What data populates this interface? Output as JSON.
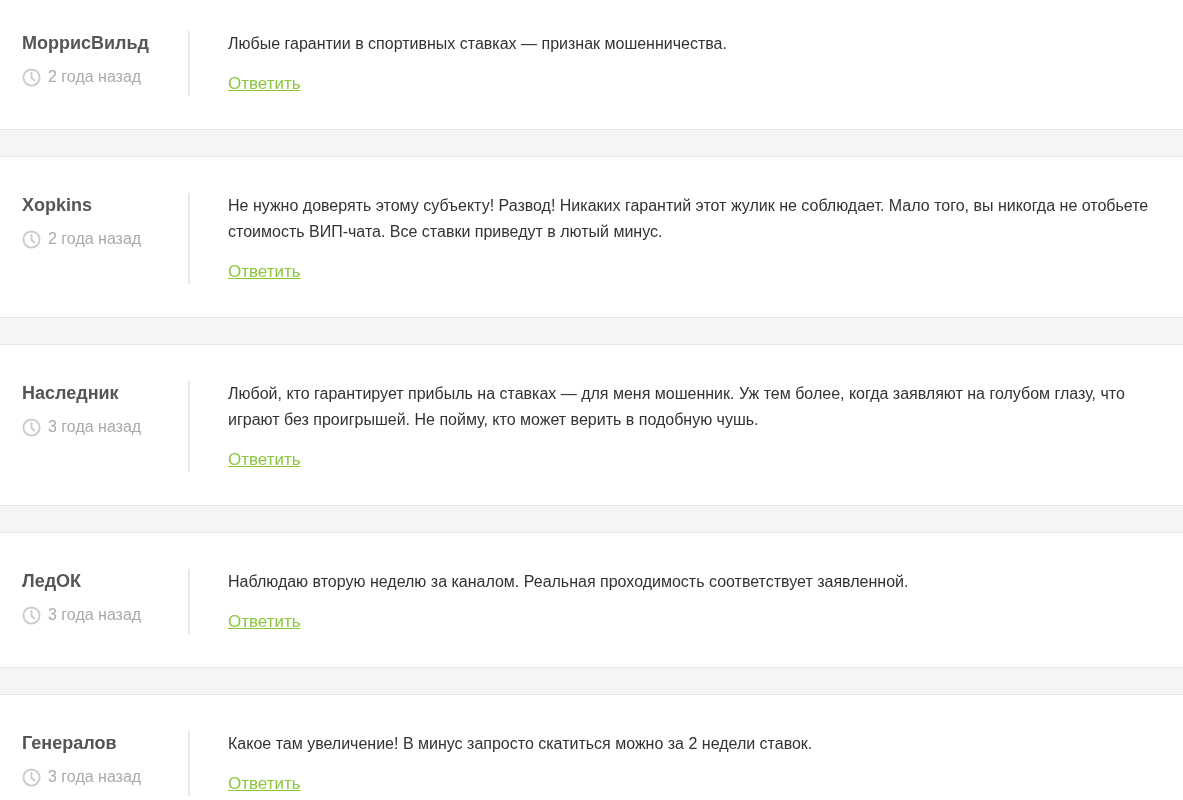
{
  "comments": [
    {
      "author": "МоррисВильд",
      "time": "2 года назад",
      "text": "Любые гарантии в спортивных ставках — признак мошенничества.",
      "reply": "Ответить"
    },
    {
      "author": "Xopkins",
      "time": "2 года назад",
      "text": "Не нужно доверять этому субъекту! Развод! Никаких гарантий этот жулик не соблюдает. Мало того, вы никогда не отобьете стоимость ВИП-чата. Все ставки приведут в лютый минус.",
      "reply": "Ответить"
    },
    {
      "author": "Наследник",
      "time": "3 года назад",
      "text": "Любой, кто гарантирует прибыль на ставках — для меня мошенник. Уж тем более, когда заявляют на голубом глазу, что играют без проигрышей. Не пойму, кто может верить в подобную чушь.",
      "reply": "Ответить"
    },
    {
      "author": "ЛедОК",
      "time": "3 года назад",
      "text": "Наблюдаю вторую неделю за каналом. Реальная проходимость соответствует заявленной.",
      "reply": "Ответить"
    },
    {
      "author": "Генералов",
      "time": "3 года назад",
      "text": "Какое там увеличение! В минус запросто скатиться можно за 2 недели ставок.",
      "reply": "Ответить"
    }
  ]
}
